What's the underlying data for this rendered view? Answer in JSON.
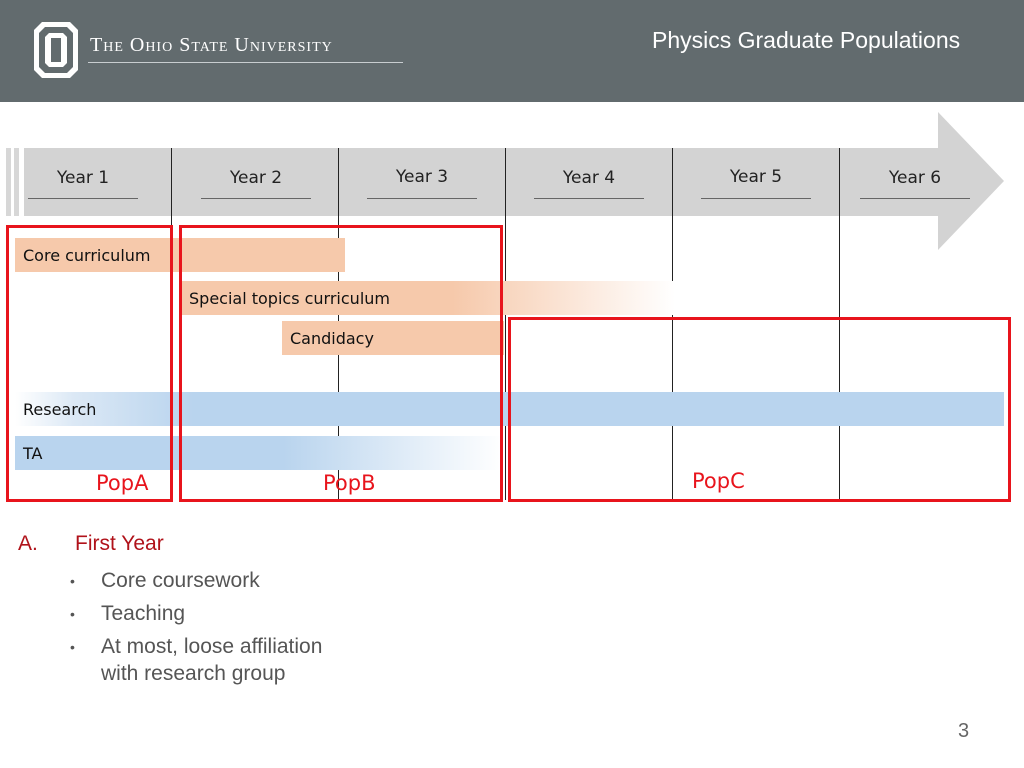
{
  "header": {
    "university": "The Ohio State University",
    "title": "Physics Graduate Populations"
  },
  "years": [
    "Year 1",
    "Year 2",
    "Year 3",
    "Year 4",
    "Year 5",
    "Year 6"
  ],
  "bars": {
    "core": "Core curriculum",
    "special": "Special topics curriculum",
    "candidacy": "Candidacy",
    "research": "Research",
    "ta": "TA"
  },
  "populations": [
    "PopA",
    "PopB",
    "PopC"
  ],
  "list": {
    "marker": "A.",
    "heading": "First Year",
    "items": [
      "Core coursework",
      "Teaching",
      "At most, loose affiliation with research group"
    ]
  },
  "page_number": "3",
  "colors": {
    "header": "#626b6e",
    "pop_outline": "#e8141c",
    "curriculum_bar": "#f6c9ab",
    "research_bar": "#b9d4ee",
    "timeline_arrow": "#d3d3d3"
  }
}
